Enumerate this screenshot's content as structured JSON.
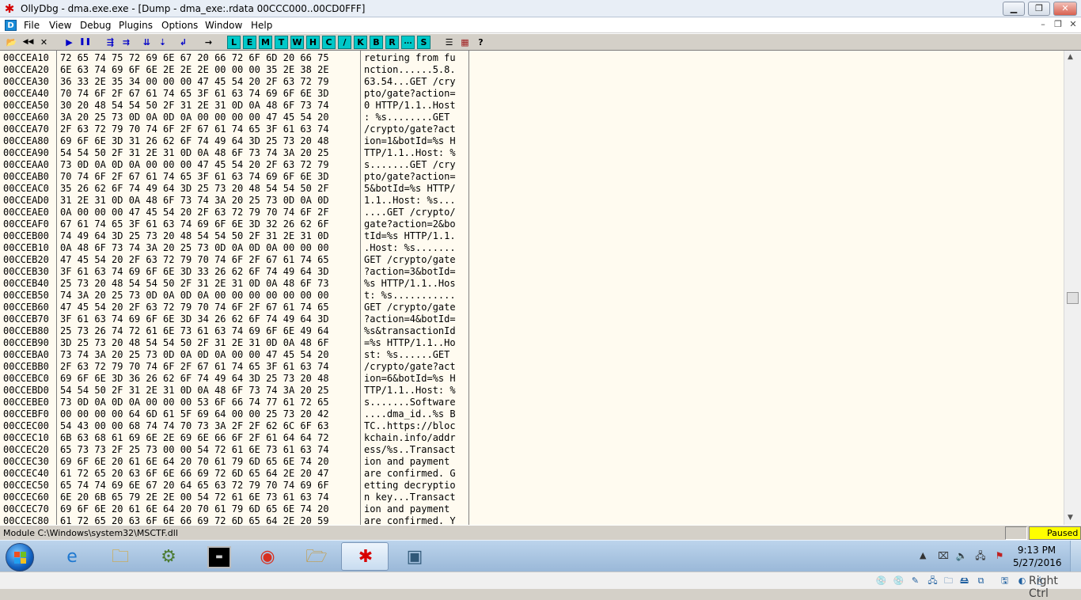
{
  "window": {
    "title": "OllyDbg - dma.exe.exe - [Dump - dma_exe:.rdata 00CCC000..00CD0FFF]",
    "min_glyph": "▁",
    "restore_glyph": "❐",
    "close_glyph": "✕"
  },
  "menubar": {
    "app_icon_text": "D",
    "items": [
      "File",
      "View",
      "Debug",
      "Plugins",
      "Options",
      "Window",
      "Help"
    ],
    "mdi": {
      "min": "–",
      "restore": "❐",
      "close": "✕"
    }
  },
  "toolbar": {
    "buttons": [
      {
        "name": "open-icon",
        "glyph": "📂"
      },
      {
        "name": "rewind-icon",
        "glyph": "◀◀"
      },
      {
        "name": "close-icon",
        "glyph": "✕"
      },
      {
        "name": "run-icon",
        "glyph": "▶"
      },
      {
        "name": "pause-icon",
        "glyph": "❚❚"
      },
      {
        "name": "step-into-icon",
        "glyph": "⇶"
      },
      {
        "name": "step-over-icon",
        "glyph": "⇉"
      },
      {
        "name": "trace-into-icon",
        "glyph": "⇊"
      },
      {
        "name": "trace-over-icon",
        "glyph": "⇣"
      },
      {
        "name": "execute-till-return-icon",
        "glyph": "↲"
      },
      {
        "name": "go-to-icon",
        "glyph": "→"
      }
    ],
    "letters": [
      "L",
      "E",
      "M",
      "T",
      "W",
      "H",
      "C",
      "/",
      "K",
      "B",
      "R",
      "...",
      "S"
    ],
    "tail": [
      {
        "name": "list-icon",
        "glyph": "☰"
      },
      {
        "name": "appearance-icon",
        "glyph": "▦"
      },
      {
        "name": "help-icon",
        "glyph": "?"
      }
    ]
  },
  "dump": {
    "rows": [
      {
        "addr": "00CCEA10",
        "hex": "72 65 74 75 72 69 6E 67 20 66 72 6F 6D 20 66 75",
        "ascii": "returing from fu"
      },
      {
        "addr": "00CCEA20",
        "hex": "6E 63 74 69 6F 6E 2E 2E 2E 00 00 00 35 2E 38 2E",
        "ascii": "nction......5.8."
      },
      {
        "addr": "00CCEA30",
        "hex": "36 33 2E 35 34 00 00 00 47 45 54 20 2F 63 72 79",
        "ascii": "63.54...GET /cry"
      },
      {
        "addr": "00CCEA40",
        "hex": "70 74 6F 2F 67 61 74 65 3F 61 63 74 69 6F 6E 3D",
        "ascii": "pto/gate?action="
      },
      {
        "addr": "00CCEA50",
        "hex": "30 20 48 54 54 50 2F 31 2E 31 0D 0A 48 6F 73 74",
        "ascii": "0 HTTP/1.1..Host"
      },
      {
        "addr": "00CCEA60",
        "hex": "3A 20 25 73 0D 0A 0D 0A 00 00 00 00 47 45 54 20",
        "ascii": ": %s........GET "
      },
      {
        "addr": "00CCEA70",
        "hex": "2F 63 72 79 70 74 6F 2F 67 61 74 65 3F 61 63 74",
        "ascii": "/crypto/gate?act"
      },
      {
        "addr": "00CCEA80",
        "hex": "69 6F 6E 3D 31 26 62 6F 74 49 64 3D 25 73 20 48",
        "ascii": "ion=1&botId=%s H"
      },
      {
        "addr": "00CCEA90",
        "hex": "54 54 50 2F 31 2E 31 0D 0A 48 6F 73 74 3A 20 25",
        "ascii": "TTP/1.1..Host: %"
      },
      {
        "addr": "00CCEAA0",
        "hex": "73 0D 0A 0D 0A 00 00 00 47 45 54 20 2F 63 72 79",
        "ascii": "s.......GET /cry"
      },
      {
        "addr": "00CCEAB0",
        "hex": "70 74 6F 2F 67 61 74 65 3F 61 63 74 69 6F 6E 3D",
        "ascii": "pto/gate?action="
      },
      {
        "addr": "00CCEAC0",
        "hex": "35 26 62 6F 74 49 64 3D 25 73 20 48 54 54 50 2F",
        "ascii": "5&botId=%s HTTP/"
      },
      {
        "addr": "00CCEAD0",
        "hex": "31 2E 31 0D 0A 48 6F 73 74 3A 20 25 73 0D 0A 0D",
        "ascii": "1.1..Host: %s..."
      },
      {
        "addr": "00CCEAE0",
        "hex": "0A 00 00 00 47 45 54 20 2F 63 72 79 70 74 6F 2F",
        "ascii": "....GET /crypto/"
      },
      {
        "addr": "00CCEAF0",
        "hex": "67 61 74 65 3F 61 63 74 69 6F 6E 3D 32 26 62 6F",
        "ascii": "gate?action=2&bo"
      },
      {
        "addr": "00CCEB00",
        "hex": "74 49 64 3D 25 73 20 48 54 54 50 2F 31 2E 31 0D",
        "ascii": "tId=%s HTTP/1.1."
      },
      {
        "addr": "00CCEB10",
        "hex": "0A 48 6F 73 74 3A 20 25 73 0D 0A 0D 0A 00 00 00",
        "ascii": ".Host: %s......."
      },
      {
        "addr": "00CCEB20",
        "hex": "47 45 54 20 2F 63 72 79 70 74 6F 2F 67 61 74 65",
        "ascii": "GET /crypto/gate"
      },
      {
        "addr": "00CCEB30",
        "hex": "3F 61 63 74 69 6F 6E 3D 33 26 62 6F 74 49 64 3D",
        "ascii": "?action=3&botId="
      },
      {
        "addr": "00CCEB40",
        "hex": "25 73 20 48 54 54 50 2F 31 2E 31 0D 0A 48 6F 73",
        "ascii": "%s HTTP/1.1..Hos"
      },
      {
        "addr": "00CCEB50",
        "hex": "74 3A 20 25 73 0D 0A 0D 0A 00 00 00 00 00 00 00",
        "ascii": "t: %s..........."
      },
      {
        "addr": "00CCEB60",
        "hex": "47 45 54 20 2F 63 72 79 70 74 6F 2F 67 61 74 65",
        "ascii": "GET /crypto/gate"
      },
      {
        "addr": "00CCEB70",
        "hex": "3F 61 63 74 69 6F 6E 3D 34 26 62 6F 74 49 64 3D",
        "ascii": "?action=4&botId="
      },
      {
        "addr": "00CCEB80",
        "hex": "25 73 26 74 72 61 6E 73 61 63 74 69 6F 6E 49 64",
        "ascii": "%s&transactionId"
      },
      {
        "addr": "00CCEB90",
        "hex": "3D 25 73 20 48 54 54 50 2F 31 2E 31 0D 0A 48 6F",
        "ascii": "=%s HTTP/1.1..Ho"
      },
      {
        "addr": "00CCEBA0",
        "hex": "73 74 3A 20 25 73 0D 0A 0D 0A 00 00 47 45 54 20",
        "ascii": "st: %s......GET "
      },
      {
        "addr": "00CCEBB0",
        "hex": "2F 63 72 79 70 74 6F 2F 67 61 74 65 3F 61 63 74",
        "ascii": "/crypto/gate?act"
      },
      {
        "addr": "00CCEBC0",
        "hex": "69 6F 6E 3D 36 26 62 6F 74 49 64 3D 25 73 20 48",
        "ascii": "ion=6&botId=%s H"
      },
      {
        "addr": "00CCEBD0",
        "hex": "54 54 50 2F 31 2E 31 0D 0A 48 6F 73 74 3A 20 25",
        "ascii": "TTP/1.1..Host: %"
      },
      {
        "addr": "00CCEBE0",
        "hex": "73 0D 0A 0D 0A 00 00 00 53 6F 66 74 77 61 72 65",
        "ascii": "s.......Software"
      },
      {
        "addr": "00CCEBF0",
        "hex": "00 00 00 00 64 6D 61 5F 69 64 00 00 25 73 20 42",
        "ascii": "....dma_id..%s B"
      },
      {
        "addr": "00CCEC00",
        "hex": "54 43 00 00 68 74 74 70 73 3A 2F 2F 62 6C 6F 63",
        "ascii": "TC..https://bloc"
      },
      {
        "addr": "00CCEC10",
        "hex": "6B 63 68 61 69 6E 2E 69 6E 66 6F 2F 61 64 64 72",
        "ascii": "kchain.info/addr"
      },
      {
        "addr": "00CCEC20",
        "hex": "65 73 73 2F 25 73 00 00 54 72 61 6E 73 61 63 74",
        "ascii": "ess/%s..Transact"
      },
      {
        "addr": "00CCEC30",
        "hex": "69 6F 6E 20 61 6E 64 20 70 61 79 6D 65 6E 74 20",
        "ascii": "ion and payment "
      },
      {
        "addr": "00CCEC40",
        "hex": "61 72 65 20 63 6F 6E 66 69 72 6D 65 64 2E 20 47",
        "ascii": "are confirmed. G"
      },
      {
        "addr": "00CCEC50",
        "hex": "65 74 74 69 6E 67 20 64 65 63 72 79 70 74 69 6F",
        "ascii": "etting decryptio"
      },
      {
        "addr": "00CCEC60",
        "hex": "6E 20 6B 65 79 2E 2E 00 54 72 61 6E 73 61 63 74",
        "ascii": "n key...Transact"
      },
      {
        "addr": "00CCEC70",
        "hex": "69 6F 6E 20 61 6E 64 20 70 61 79 6D 65 6E 74 20",
        "ascii": "ion and payment "
      },
      {
        "addr": "00CCEC80",
        "hex": "61 72 65 20 63 6F 6E 66 69 72 6D 65 64 2E 20 59",
        "ascii": "are confirmed. Y"
      }
    ]
  },
  "scrollbar": {
    "up": "▲",
    "down": "▼"
  },
  "status": {
    "module_text": "Module C:\\Windows\\system32\\MSCTF.dll",
    "state": "Paused"
  },
  "taskbar": {
    "apps": [
      {
        "name": "internet-explorer-icon",
        "glyph": "e",
        "color": "#1e78d0",
        "active": false
      },
      {
        "name": "file-explorer-icon",
        "glyph": "🗀",
        "color": "#d8a020",
        "active": false
      },
      {
        "name": "windows-update-icon",
        "glyph": "⚙",
        "color": "#4a7a30",
        "active": false
      },
      {
        "name": "command-prompt-icon",
        "glyph": "▬",
        "color": "#000000",
        "active": false
      },
      {
        "name": "chrome-icon",
        "glyph": "◉",
        "color": "#d83020",
        "active": false
      },
      {
        "name": "folder-icon",
        "glyph": "🗁",
        "color": "#c89020",
        "active": false
      },
      {
        "name": "ollydbg-icon",
        "glyph": "✱",
        "color": "#d80000",
        "active": true
      },
      {
        "name": "window-app-icon",
        "glyph": "▣",
        "color": "#305878",
        "active": false
      }
    ],
    "tray_arrow": "▲",
    "tray_icons": [
      {
        "name": "usb-device-icon",
        "glyph": "⌧"
      },
      {
        "name": "speaker-icon",
        "glyph": "🔈"
      },
      {
        "name": "network-icon",
        "glyph": "🖧"
      },
      {
        "name": "action-center-icon",
        "glyph": "⚑"
      }
    ],
    "clock_time": "9:13 PM",
    "clock_date": "5/27/2016"
  },
  "vm_statusbar": {
    "icons": [
      "💿",
      "💿",
      "✎",
      "🖧",
      "🗀",
      "🖴",
      "⧉",
      "🖫",
      "◐",
      "🖱"
    ],
    "host_key": "Right Ctrl"
  },
  "colors": {
    "dump_bg": "#fffbf0",
    "toolbar_letter_bg": "#00c8c8",
    "paused_bg": "#ffff00"
  }
}
